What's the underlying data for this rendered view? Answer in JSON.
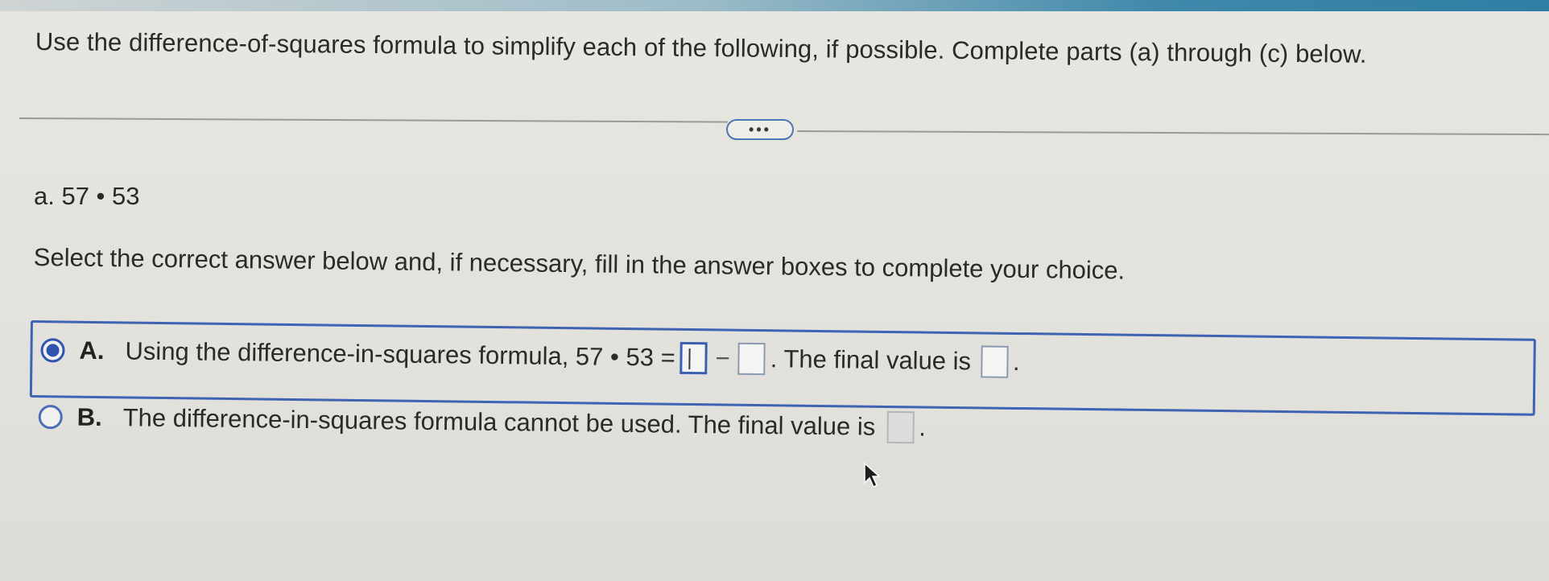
{
  "question": {
    "text": "Use the difference-of-squares formula to simplify each of the following, if possible. Complete parts (a) through (c) below."
  },
  "expand_button": {
    "label": "•••"
  },
  "part_a": {
    "label": "a. 57 • 53"
  },
  "instruction": {
    "text": "Select the correct answer below and, if necessary, fill in the answer boxes to complete your choice."
  },
  "choices": {
    "a": {
      "letter": "A.",
      "text_before": "Using the difference-in-squares formula, 57 • 53 =",
      "operator": "−",
      "text_after": ". The final value is",
      "end": ".",
      "selected": true
    },
    "b": {
      "letter": "B.",
      "text_before": "The difference-in-squares formula cannot be used. The final value is",
      "end": ".",
      "selected": false
    }
  },
  "colors": {
    "accent": "#3f63b3",
    "top_bar": "#2f7ea4"
  },
  "icons": {
    "cursor": "mouse-pointer-icon"
  }
}
